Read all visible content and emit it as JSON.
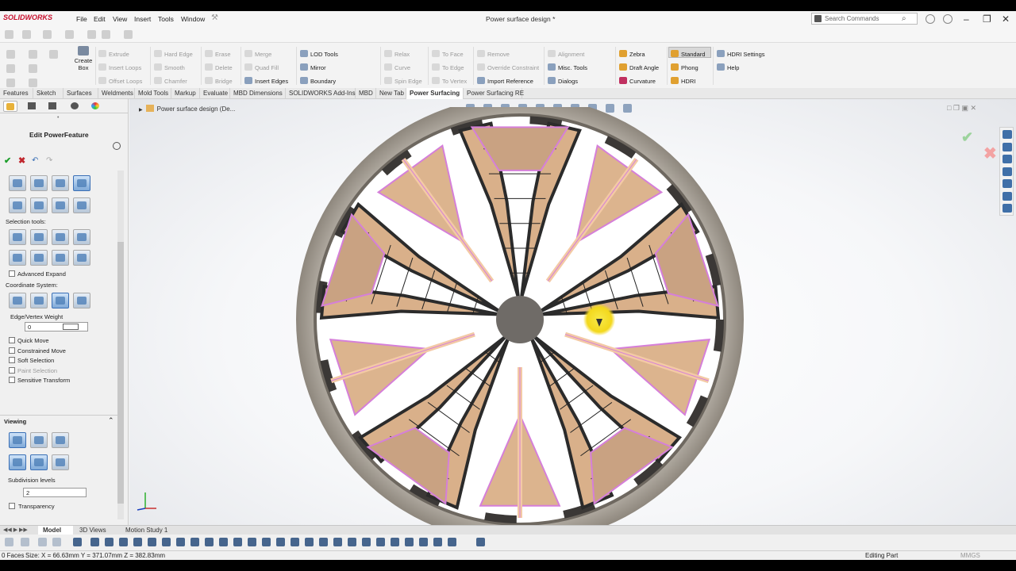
{
  "app": {
    "brand": "SOLIDWORKS",
    "document_title": "Power surface design *"
  },
  "menu": [
    "File",
    "Edit",
    "View",
    "Insert",
    "Tools",
    "Window"
  ],
  "search": {
    "placeholder": "Search Commands"
  },
  "command_manager": {
    "create_box": "Create Box",
    "columns": [
      [
        "Extrude",
        "Insert Loops",
        "Offset Loops"
      ],
      [
        "Hard Edge",
        "Smooth",
        "Chamfer"
      ],
      [
        "Erase",
        "Delete",
        "Bridge"
      ],
      [
        "Merge",
        "Quad Fill",
        "Insert Edges"
      ],
      [
        "LOD Tools",
        "Mirror",
        "Boundary"
      ],
      [
        "Relax",
        "Curve",
        "Spin Edge"
      ],
      [
        "To Face",
        "To Edge",
        "To Vertex"
      ],
      [
        "Remove",
        "Override Constraint",
        "Import Reference"
      ],
      [
        "Alignment",
        "Misc. Tools",
        "Dialogs"
      ],
      [
        "Zebra",
        "Draft Angle",
        "Curvature"
      ],
      [
        "Standard",
        "Phong",
        "HDRI"
      ],
      [
        "HDRI Settings",
        "Help"
      ]
    ]
  },
  "tabs": [
    "Features",
    "Sketch",
    "Surfaces",
    "Weldments",
    "Mold Tools",
    "Markup",
    "Evaluate",
    "MBD Dimensions",
    "SOLIDWORKS Add-Ins",
    "MBD",
    "New Tab",
    "Power Surfacing",
    "Power Surfacing RE"
  ],
  "active_tab": "Power Surfacing",
  "panel": {
    "title": "Edit PowerFeature",
    "selection_tools_label": "Selection tools:",
    "advanced_expand": "Advanced Expand",
    "coordinate_system": "Coordinate System:",
    "edge_vertex_weight_label": "Edge/Vertex Weight",
    "edge_vertex_weight_value": "0",
    "options": [
      "Quick Move",
      "Constrained Move",
      "Soft Selection",
      "Paint Selection",
      "Sensitive Transform"
    ],
    "viewing_header": "Viewing",
    "subdivision_label": "Subdivision levels",
    "subdivision_value": "2",
    "transparency": "Transparency"
  },
  "tree": {
    "root": "Power surface design (De..."
  },
  "bottom_tabs": [
    "Model",
    "3D Views",
    "Motion Study 1"
  ],
  "active_bottom_tab": "Model",
  "status": {
    "faces": "0 Faces",
    "size": "Size: X = 66.63mm Y = 371.07mm Z = 382.83mm",
    "mode": "Editing Part",
    "units": "MMGS"
  },
  "colors": {
    "face_fill": "#dcb48e",
    "edge_highlight": "#d57fd9",
    "rim": "#a59f96"
  }
}
